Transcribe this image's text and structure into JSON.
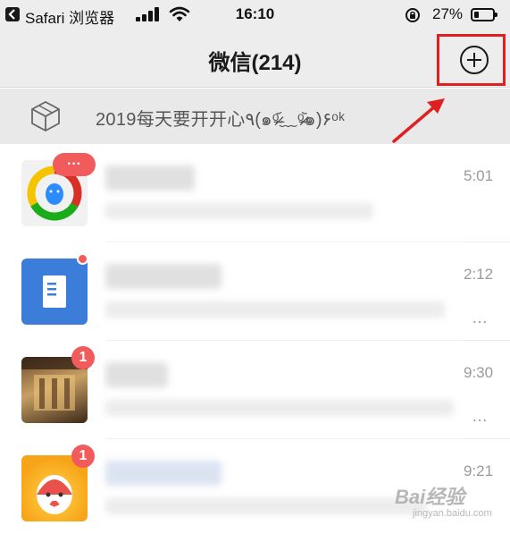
{
  "status_bar": {
    "app": "Safari 浏览器",
    "time": "16:10",
    "battery": "27%",
    "battery_level": 0.27
  },
  "header": {
    "title": "微信(214)",
    "add_button_icon": "plus-circle-icon"
  },
  "pc_banner": {
    "icon": "box-icon",
    "text": "2019每天要开开心٩(๑ᵒ̴̶̷᷄﹏ᵒ̴̶̷᷅๑)۶ᵒᵏ"
  },
  "chats": [
    {
      "avatar": "qq-app-icon",
      "time": "5:01",
      "badge": "···",
      "has_dots": false
    },
    {
      "avatar": "document-app-icon",
      "time": "2:12",
      "badge": "",
      "has_dots": true
    },
    {
      "avatar": "photo-avatar",
      "time": "9:30",
      "badge": "1",
      "has_dots": true
    },
    {
      "avatar": "cartoon-avatar",
      "time": "9:21",
      "badge": "1",
      "has_dots": false
    }
  ],
  "watermark": {
    "text": "Bai经验",
    "sub": "jingyan.baidu.com"
  },
  "colors": {
    "header_bg": "#ededed",
    "badge_red": "#f15b5b",
    "highlight_red": "#e02020"
  }
}
